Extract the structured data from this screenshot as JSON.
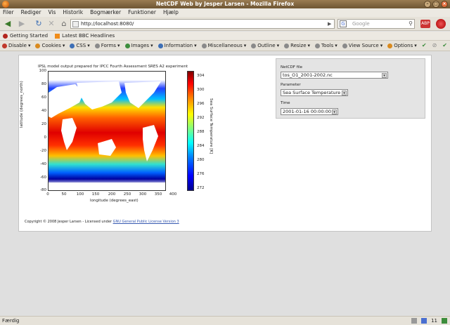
{
  "window": {
    "title": "NetCDF Web by Jesper Larsen - Mozilla Firefox"
  },
  "menu": [
    "Filer",
    "Rediger",
    "Vis",
    "Historik",
    "Bogmærker",
    "Funktioner",
    "Hjælp"
  ],
  "nav": {
    "url": "http://localhost:8080/",
    "search_placeholder": "Google"
  },
  "bookmarks": [
    "Getting Started",
    "Latest BBC Headlines"
  ],
  "devtoolbar": [
    "Disable",
    "Cookies",
    "CSS",
    "Forms",
    "Images",
    "Information",
    "Miscellaneous",
    "Outline",
    "Resize",
    "Tools",
    "View Source",
    "Options"
  ],
  "plot": {
    "title": "IPSL model output prepared for IPCC Fourth Assessment SRES A2 experiment",
    "xlabel": "longitude (degrees_east)",
    "ylabel": "latitude (degrees_north)",
    "yticks": [
      "100",
      "80",
      "60",
      "40",
      "20",
      "0",
      "-20",
      "-40",
      "-60",
      "-80"
    ],
    "xticks": [
      "0",
      "50",
      "100",
      "150",
      "200",
      "250",
      "300",
      "350",
      "400"
    ],
    "colorbar_ticks": [
      "304",
      "300",
      "296",
      "292",
      "288",
      "284",
      "280",
      "276",
      "272"
    ],
    "colorbar_label": "Sea Surface Temperature [K]"
  },
  "copyright": {
    "text": "Copyright © 2008 Jesper Larsen - Licensed under",
    "link": "GNU General Public License Version 3"
  },
  "form": {
    "netcdf_label": "NetCDF file",
    "netcdf_value": "tos_O1_2001-2002.nc",
    "param_label": "Parameter",
    "param_value": "Sea Surface Temperature",
    "time_label": "Time",
    "time_value": "2001-01-16 00:00:00"
  },
  "status": {
    "text": "Færdig",
    "count": "11"
  },
  "colors": {
    "titlebar": "#6e5533",
    "link": "#3558b0"
  }
}
